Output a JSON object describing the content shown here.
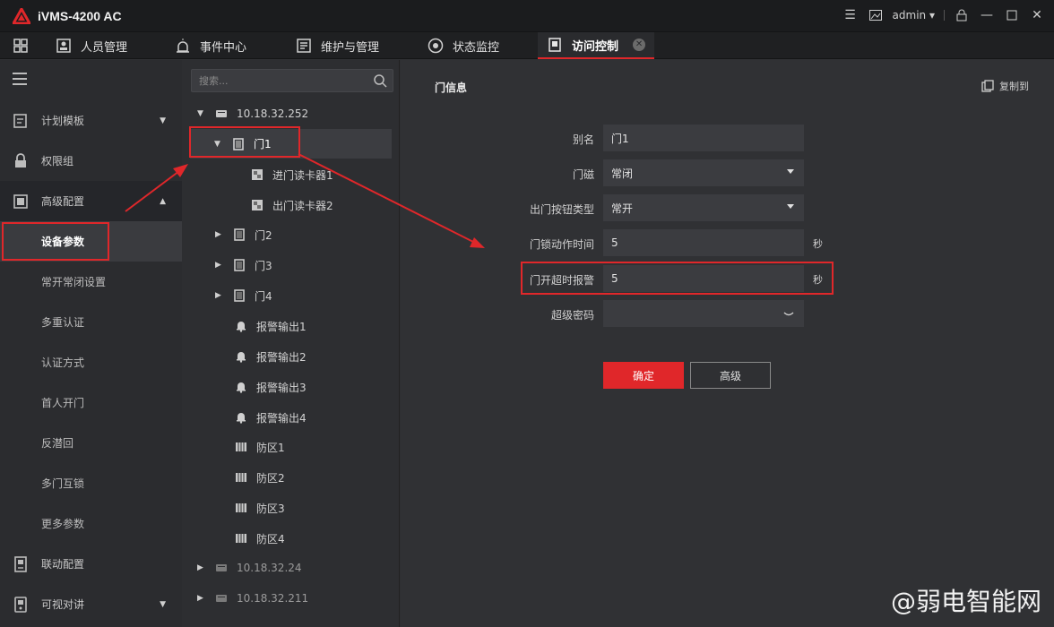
{
  "app": {
    "title": "iVMS-4200 AC",
    "user": "admin",
    "brand_color": "#e0272a"
  },
  "modules": [
    {
      "label": "人员管理",
      "icon": "person-management-icon"
    },
    {
      "label": "事件中心",
      "icon": "alarm-siren-icon"
    },
    {
      "label": "维护与管理",
      "icon": "maintenance-icon"
    },
    {
      "label": "状态监控",
      "icon": "status-monitor-icon"
    },
    {
      "label": "访问控制",
      "icon": "access-control-icon",
      "active": true
    }
  ],
  "sidebar": {
    "items": [
      {
        "label": "计划模板",
        "icon": "schedule-template-icon",
        "expandable": true
      },
      {
        "label": "权限组",
        "icon": "lock-icon"
      },
      {
        "label": "高级配置",
        "icon": "advanced-config-icon",
        "expanded": true
      },
      {
        "label": "设备参数",
        "sub": true,
        "active": true
      },
      {
        "label": "常开常闭设置",
        "sub": true
      },
      {
        "label": "多重认证",
        "sub": true
      },
      {
        "label": "认证方式",
        "sub": true
      },
      {
        "label": "首人开门",
        "sub": true
      },
      {
        "label": "反潜回",
        "sub": true
      },
      {
        "label": "多门互锁",
        "sub": true
      },
      {
        "label": "更多参数",
        "sub": true
      },
      {
        "label": "联动配置",
        "icon": "linkage-icon"
      },
      {
        "label": "可视对讲",
        "icon": "intercom-icon",
        "expandable": true
      }
    ]
  },
  "tree": {
    "search_placeholder": "搜索...",
    "nodes": [
      {
        "label": "10.18.32.252",
        "type": "device",
        "expanded": true
      },
      {
        "label": "门1",
        "type": "door",
        "expanded": true,
        "selected": true
      },
      {
        "label": "进门读卡器1",
        "type": "reader"
      },
      {
        "label": "出门读卡器2",
        "type": "reader"
      },
      {
        "label": "门2",
        "type": "door"
      },
      {
        "label": "门3",
        "type": "door"
      },
      {
        "label": "门4",
        "type": "door"
      },
      {
        "label": "报警输出1",
        "type": "alarm-output"
      },
      {
        "label": "报警输出2",
        "type": "alarm-output"
      },
      {
        "label": "报警输出3",
        "type": "alarm-output"
      },
      {
        "label": "报警输出4",
        "type": "alarm-output"
      },
      {
        "label": "防区1",
        "type": "zone"
      },
      {
        "label": "防区2",
        "type": "zone"
      },
      {
        "label": "防区3",
        "type": "zone"
      },
      {
        "label": "防区4",
        "type": "zone"
      },
      {
        "label": "10.18.32.24",
        "type": "device",
        "offline": true
      },
      {
        "label": "10.18.32.211",
        "type": "device",
        "offline": true
      }
    ]
  },
  "door_info": {
    "title": "门信息",
    "copy_to": "复制到",
    "fields": [
      {
        "label": "别名",
        "value": "门1",
        "kind": "text"
      },
      {
        "label": "门磁",
        "value": "常闭",
        "kind": "select"
      },
      {
        "label": "出门按钮类型",
        "value": "常开",
        "kind": "select"
      },
      {
        "label": "门锁动作时间",
        "value": "5",
        "kind": "text",
        "unit": "秒"
      },
      {
        "label": "门开超时报警",
        "value": "5",
        "kind": "text",
        "unit": "秒"
      },
      {
        "label": "超级密码",
        "value": "",
        "kind": "password"
      }
    ],
    "buttons": {
      "ok": "确定",
      "advanced": "高级"
    }
  },
  "watermark": "@弱电智能网"
}
